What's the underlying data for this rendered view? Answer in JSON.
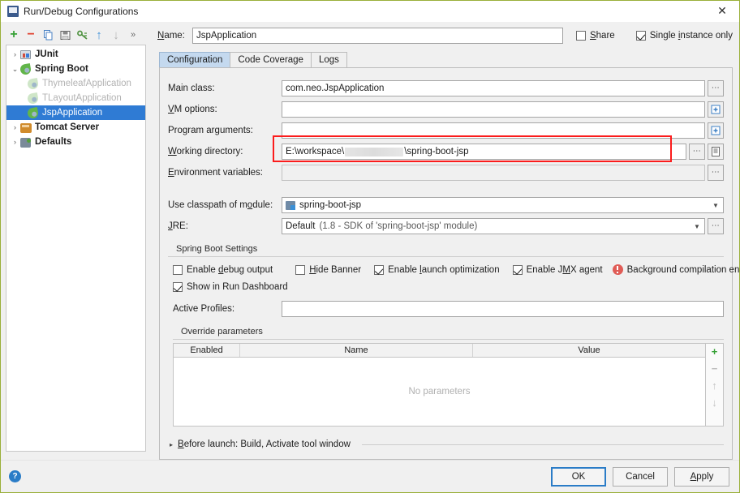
{
  "window": {
    "title": "Run/Debug Configurations",
    "title_icon": "idea-window-icon",
    "close_icon": "close-icon"
  },
  "toolbar": {
    "items": [
      {
        "name": "add-configuration-button",
        "glyph": "+",
        "color": "#35a035"
      },
      {
        "name": "remove-configuration-button",
        "glyph": "−",
        "color": "#e0402e"
      },
      {
        "name": "copy-configuration-button",
        "glyph": "copy-icon",
        "color": "#4a82c4"
      },
      {
        "name": "save-configuration-button",
        "glyph": "save-icon",
        "color": "#4a4a4a"
      },
      {
        "name": "edit-templates-button",
        "glyph": "wrench-icon",
        "color": "#4a8f3a"
      },
      {
        "name": "move-up-button",
        "glyph": "↑",
        "color": "#3b8fd6"
      },
      {
        "name": "move-down-button",
        "glyph": "↓",
        "color": "#a8a8a8"
      },
      {
        "name": "more-options-button",
        "glyph": "»",
        "color": "#6a6a6a"
      }
    ]
  },
  "tree": {
    "nodes": [
      {
        "label": "JUnit",
        "arrow": "›",
        "icon": "junit-icon",
        "bold": true,
        "indent": false,
        "selected": false,
        "dim": false
      },
      {
        "label": "Spring Boot",
        "arrow": "⌄",
        "icon": "spring-boot-icon",
        "bold": true,
        "indent": false,
        "selected": false,
        "dim": false
      },
      {
        "label": "ThymeleafApplication",
        "arrow": "",
        "icon": "spring-boot-icon",
        "bold": false,
        "indent": true,
        "selected": false,
        "dim": true
      },
      {
        "label": "TLayoutApplication",
        "arrow": "",
        "icon": "spring-boot-icon",
        "bold": false,
        "indent": true,
        "selected": false,
        "dim": true
      },
      {
        "label": "JspApplication",
        "arrow": "",
        "icon": "spring-boot-icon",
        "bold": false,
        "indent": true,
        "selected": true,
        "dim": false
      },
      {
        "label": "Tomcat Server",
        "arrow": "›",
        "icon": "tomcat-icon",
        "bold": true,
        "indent": false,
        "selected": false,
        "dim": false
      },
      {
        "label": "Defaults",
        "arrow": "›",
        "icon": "defaults-icon",
        "bold": true,
        "indent": false,
        "selected": false,
        "dim": false
      }
    ]
  },
  "name_row": {
    "label": "Name:",
    "label_mnemonic": "N",
    "value": "JspApplication",
    "share": {
      "label": "Share",
      "mnemonic": "S",
      "checked": false
    },
    "single_instance": {
      "label": "Single instance only",
      "mnemonic": "i",
      "checked": true
    }
  },
  "tabs": [
    {
      "label": "Configuration",
      "active": true
    },
    {
      "label": "Code Coverage",
      "active": false
    },
    {
      "label": "Logs",
      "active": false
    }
  ],
  "form": {
    "main_class": {
      "label": "Main class:",
      "value": "com.neo.JspApplication",
      "button": "browse-icon"
    },
    "vm_options": {
      "label": "VM options:",
      "mnemonic": "V",
      "value": "",
      "button": "expand-editor-icon"
    },
    "program_arguments": {
      "label": "Program arguments:",
      "mnemonic": "g",
      "value": "",
      "button": "expand-editor-icon"
    },
    "working_directory": {
      "label": "Working directory:",
      "mnemonic": "W",
      "value_prefix": "E:\\workspace\\",
      "value_suffix": "\\spring-boot-jsp",
      "redacted": true,
      "button": "browse-icon",
      "button2": "macros-icon",
      "highlighted": true,
      "highlight_color": "#fb1c1c"
    },
    "environment_variables": {
      "label": "Environment variables:",
      "mnemonic": "E",
      "value": "",
      "button": "browse-icon",
      "disabled": true
    },
    "use_classpath": {
      "label": "Use classpath of module:",
      "mnemonic": "o",
      "value": "spring-boot-jsp",
      "icon": "module-icon",
      "chevron": "chevron-down-icon"
    },
    "jre": {
      "label": "JRE:",
      "mnemonic": "J",
      "value_main": "Default",
      "value_detail": "(1.8 - SDK of 'spring-boot-jsp' module)",
      "chevron": "chevron-down-icon",
      "button": "browse-icon"
    }
  },
  "spring_boot_settings": {
    "legend": "Spring Boot Settings",
    "checkboxes": [
      {
        "label": "Enable debug output",
        "mnemonic": "d",
        "checked": false
      },
      {
        "label": "Hide Banner",
        "mnemonic": "H",
        "checked": false
      },
      {
        "label": "Enable launch optimization",
        "mnemonic": "l",
        "checked": true
      },
      {
        "label": "Enable JMX agent",
        "mnemonic": "M",
        "checked": true
      }
    ],
    "warning": {
      "label": "Background compilation enabled",
      "icon": "error-icon",
      "color": "#e05c56"
    },
    "run_dashboard": {
      "label": "Show in Run Dashboard",
      "checked": true
    },
    "active_profiles": {
      "label": "Active Profiles:",
      "value": ""
    }
  },
  "override_parameters": {
    "legend": "Override parameters",
    "columns": [
      "Enabled",
      "Name",
      "Value"
    ],
    "rows": [],
    "empty_text": "No parameters",
    "side_buttons": [
      {
        "name": "add-parameter-button",
        "glyph": "+",
        "color": "#35a035"
      },
      {
        "name": "remove-parameter-button",
        "glyph": "−",
        "color": "#b9b9b9"
      },
      {
        "name": "move-parameter-up-button",
        "glyph": "↑",
        "color": "#c0c0c0"
      },
      {
        "name": "move-parameter-down-button",
        "glyph": "↓",
        "color": "#c0c0c0"
      }
    ]
  },
  "before_launch": {
    "label": "Before launch: Build, Activate tool window",
    "mnemonic": "B",
    "expander": "▸"
  },
  "footer": {
    "help": "?",
    "ok": "OK",
    "cancel": "Cancel",
    "apply": "Apply"
  }
}
